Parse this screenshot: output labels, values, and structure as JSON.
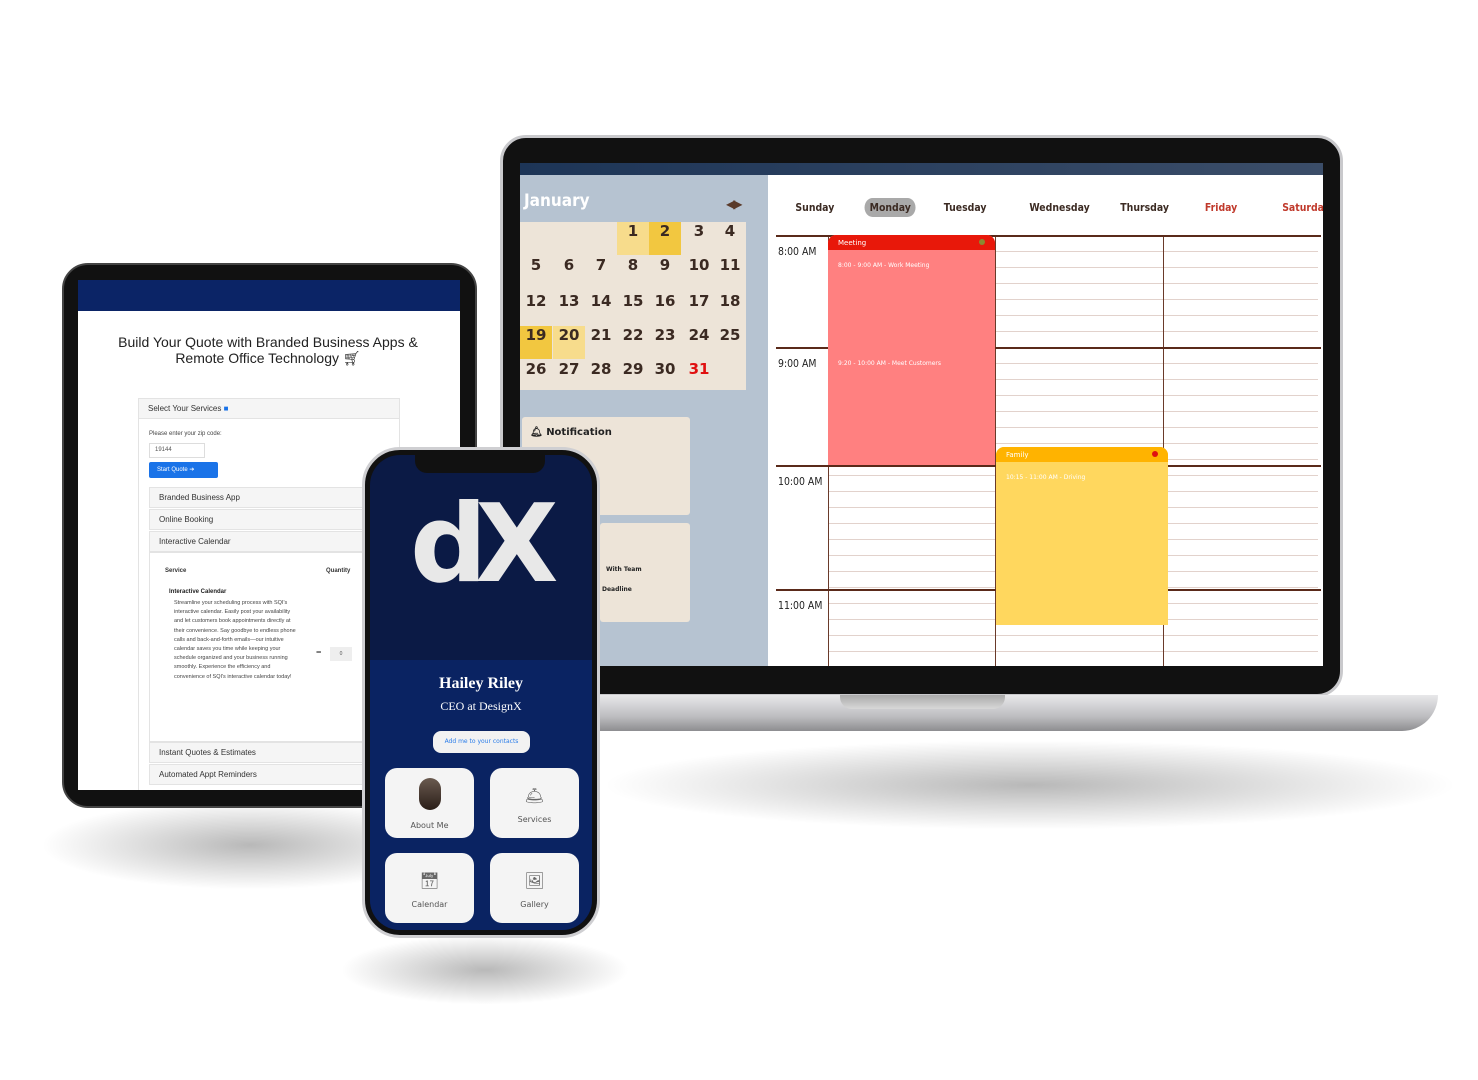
{
  "laptop": {
    "month": "January",
    "nav_arrows": "◀▶",
    "weeks": [
      [
        null,
        null,
        null,
        1,
        2,
        3,
        4
      ],
      [
        5,
        6,
        7,
        8,
        9,
        10,
        11
      ],
      [
        12,
        13,
        14,
        15,
        16,
        17,
        18
      ],
      [
        19,
        20,
        21,
        22,
        23,
        24,
        25
      ],
      [
        26,
        27,
        28,
        29,
        30,
        31,
        null
      ]
    ],
    "highlighted_days": [
      1,
      20
    ],
    "selected_days": [
      2,
      19
    ],
    "red_days": [
      31
    ],
    "notification": {
      "label": "Notification",
      "icon": "bell-icon"
    },
    "card_items": [
      "With Team",
      "Deadline"
    ],
    "days": [
      "Sunday",
      "Monday",
      "Tuesday",
      "Wednesday",
      "Thursday",
      "Friday",
      "Saturday"
    ],
    "active_day": "Monday",
    "times": [
      "8:00 AM",
      "9:00 AM",
      "10:00 AM",
      "11:00 AM"
    ],
    "events": [
      {
        "category": "Meeting",
        "color": "#e8180a",
        "body_color": "#ff8080",
        "items": [
          "8:00 - 9:00 AM  - Work Meeting",
          "9:20 - 10:00 AM  - Meet Customers"
        ]
      },
      {
        "category": "Family",
        "color": "#ffb300",
        "body_color": "#ffd75e",
        "items": [
          "10:15 - 11:00 AM  - Driving"
        ]
      }
    ]
  },
  "tablet": {
    "title": "Build Your Quote with Branded Business Apps & Remote Office Technology",
    "panel_title": "Select Your Services",
    "zip_label": "Please enter your zip code:",
    "zip_value": "19144",
    "start_button": "Start Quote",
    "services": [
      "Branded Business App",
      "Online Booking",
      "Interactive Calendar"
    ],
    "table": {
      "col_service": "Service",
      "col_quantity": "Quantity",
      "item_title": "Interactive Calendar",
      "item_desc": "Streamline your scheduling process with SQI's interactive calendar. Easily post your availability and let customers book appointments directly at their convenience. Say goodbye to endless phone calls and back-and-forth emails—our intuitive calendar saves you time while keeping your schedule organized and your business running smoothly. Experience the efficiency and convenience of SQI's interactive calendar today!",
      "quantity": "0",
      "minus": "−",
      "plus": "+"
    },
    "more_services": [
      "Instant Quotes & Estimates",
      "Automated Appt Reminders"
    ]
  },
  "phone": {
    "logo": "dX",
    "name": "Hailey Riley",
    "role": "CEO at DesignX",
    "contact_button": "Add me to your contacts",
    "tiles": [
      {
        "label": "About Me",
        "icon": "avatar"
      },
      {
        "label": "Services",
        "icon": "service-bell-icon"
      },
      {
        "label": "Calendar",
        "icon": "calendar-icon"
      },
      {
        "label": "Gallery",
        "icon": "gallery-icon"
      }
    ]
  }
}
